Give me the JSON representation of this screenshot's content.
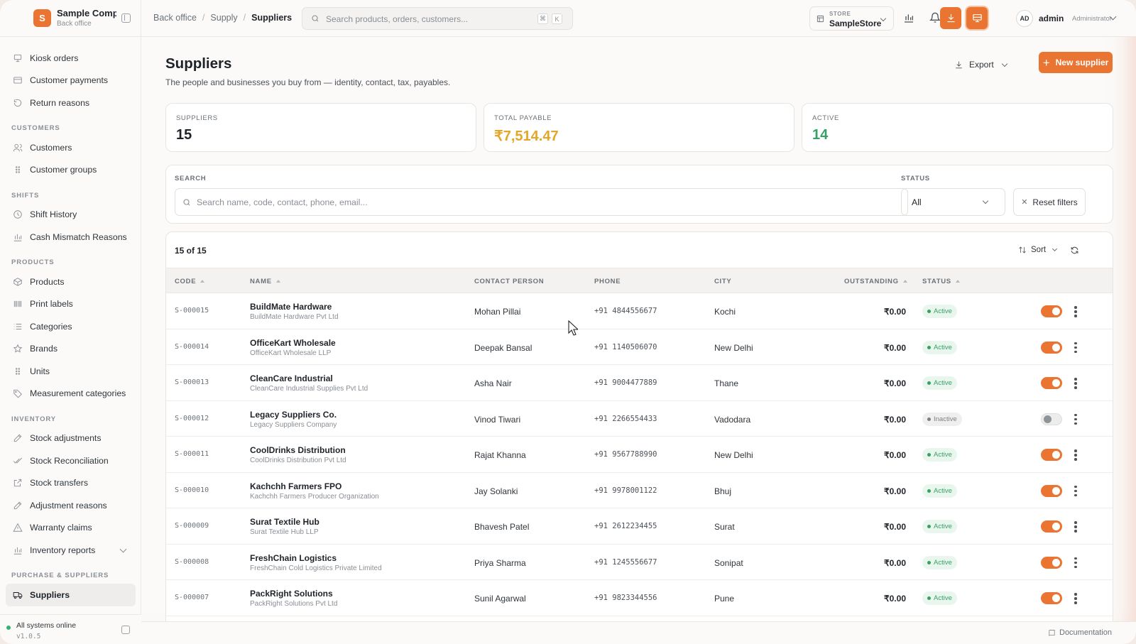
{
  "brand": {
    "name": "Sample Company",
    "sub": "Back office",
    "initial": "S"
  },
  "sidebar": {
    "groups": [
      {
        "section": "",
        "items": [
          {
            "label": "Kiosk orders",
            "icon": "kiosk-icon"
          },
          {
            "label": "Customer payments",
            "icon": "payments-icon"
          },
          {
            "label": "Return reasons",
            "icon": "return-icon"
          }
        ]
      },
      {
        "section": "CUSTOMERS",
        "items": [
          {
            "label": "Customers",
            "icon": "users-icon"
          },
          {
            "label": "Customer groups",
            "icon": "grip-icon"
          }
        ]
      },
      {
        "section": "SHIFTS",
        "items": [
          {
            "label": "Shift History",
            "icon": "clock-icon"
          },
          {
            "label": "Cash Mismatch Reasons",
            "icon": "bar-chart-icon"
          }
        ]
      },
      {
        "section": "PRODUCTS",
        "items": [
          {
            "label": "Products",
            "icon": "box-icon"
          },
          {
            "label": "Print labels",
            "icon": "barcode-icon"
          },
          {
            "label": "Categories",
            "icon": "list-icon"
          },
          {
            "label": "Brands",
            "icon": "star-icon"
          },
          {
            "label": "Units",
            "icon": "grip-icon"
          },
          {
            "label": "Measurement categories",
            "icon": "tag-icon"
          }
        ]
      },
      {
        "section": "INVENTORY",
        "items": [
          {
            "label": "Stock adjustments",
            "icon": "edit-icon"
          },
          {
            "label": "Stock Reconciliation",
            "icon": "check-check-icon"
          },
          {
            "label": "Stock transfers",
            "icon": "external-link-icon"
          },
          {
            "label": "Adjustment reasons",
            "icon": "edit-icon"
          },
          {
            "label": "Warranty claims",
            "icon": "alert-triangle-icon"
          },
          {
            "label": "Inventory reports",
            "icon": "bar-chart-icon",
            "expandable": true
          }
        ]
      },
      {
        "section": "PURCHASE & SUPPLIERS",
        "items": [
          {
            "label": "Suppliers",
            "icon": "truck-icon",
            "active": true
          }
        ]
      }
    ],
    "status": "All systems online",
    "version": "v1.0.5"
  },
  "topbar": {
    "breadcrumb": [
      "Back office",
      "Supply",
      "Suppliers"
    ],
    "search_placeholder": "Search products, orders, customers...",
    "kbd": [
      "⌘",
      "K"
    ],
    "store_label": "STORE",
    "store_value": "SampleStore",
    "user_initials": "AD",
    "user_name": "admin",
    "user_role": "Administrator"
  },
  "page": {
    "title": "Suppliers",
    "subtitle": "The people and businesses you buy from — identity, contact, tax, payables.",
    "export_label": "Export",
    "new_label": "New supplier"
  },
  "stats": [
    {
      "label": "SUPPLIERS",
      "value": "15",
      "color": "#1f2328"
    },
    {
      "label": "TOTAL PAYABLE",
      "value": "₹7,514.47",
      "color": "#e3a52a"
    },
    {
      "label": "ACTIVE",
      "value": "14",
      "color": "#37a063"
    }
  ],
  "filters": {
    "search_label": "SEARCH",
    "search_placeholder": "Search name, code, contact, phone, email...",
    "status_label": "STATUS",
    "status_value": "All",
    "reset_label": "Reset filters"
  },
  "table": {
    "count": "15 of 15",
    "sort_label": "Sort",
    "columns": [
      "CODE",
      "NAME",
      "CONTACT PERSON",
      "PHONE",
      "CITY",
      "OUTSTANDING",
      "STATUS"
    ],
    "rows": [
      {
        "code": "S-000015",
        "name": "BuildMate Hardware",
        "legal": "BuildMate Hardware Pvt Ltd",
        "contact": "Mohan Pillai",
        "phone": "+91 4844556677",
        "city": "Kochi",
        "outstanding": "₹0.00",
        "status": "Active",
        "enabled": true
      },
      {
        "code": "S-000014",
        "name": "OfficeKart Wholesale",
        "legal": "OfficeKart Wholesale LLP",
        "contact": "Deepak Bansal",
        "phone": "+91 1140506070",
        "city": "New Delhi",
        "outstanding": "₹0.00",
        "status": "Active",
        "enabled": true
      },
      {
        "code": "S-000013",
        "name": "CleanCare Industrial",
        "legal": "CleanCare Industrial Supplies Pvt Ltd",
        "contact": "Asha Nair",
        "phone": "+91 9004477889",
        "city": "Thane",
        "outstanding": "₹0.00",
        "status": "Active",
        "enabled": true
      },
      {
        "code": "S-000012",
        "name": "Legacy Suppliers Co.",
        "legal": "Legacy Suppliers Company",
        "contact": "Vinod Tiwari",
        "phone": "+91 2266554433",
        "city": "Vadodara",
        "outstanding": "₹0.00",
        "status": "Inactive",
        "enabled": false
      },
      {
        "code": "S-000011",
        "name": "CoolDrinks Distribution",
        "legal": "CoolDrinks Distribution Pvt Ltd",
        "contact": "Rajat Khanna",
        "phone": "+91 9567788990",
        "city": "New Delhi",
        "outstanding": "₹0.00",
        "status": "Active",
        "enabled": true
      },
      {
        "code": "S-000010",
        "name": "Kachchh Farmers FPO",
        "legal": "Kachchh Farmers Producer Organization",
        "contact": "Jay Solanki",
        "phone": "+91 9978001122",
        "city": "Bhuj",
        "outstanding": "₹0.00",
        "status": "Active",
        "enabled": true
      },
      {
        "code": "S-000009",
        "name": "Surat Textile Hub",
        "legal": "Surat Textile Hub LLP",
        "contact": "Bhavesh Patel",
        "phone": "+91 2612234455",
        "city": "Surat",
        "outstanding": "₹0.00",
        "status": "Active",
        "enabled": true
      },
      {
        "code": "S-000008",
        "name": "FreshChain Logistics",
        "legal": "FreshChain Cold Logistics Private Limited",
        "contact": "Priya Sharma",
        "phone": "+91 1245556677",
        "city": "Sonipat",
        "outstanding": "₹0.00",
        "status": "Active",
        "enabled": true
      },
      {
        "code": "S-000007",
        "name": "PackRight Solutions",
        "legal": "PackRight Solutions Pvt Ltd",
        "contact": "Sunil Agarwal",
        "phone": "+91 9823344556",
        "city": "Pune",
        "outstanding": "₹0.00",
        "status": "Active",
        "enabled": true
      }
    ]
  },
  "footer": {
    "docs_label": "Documentation"
  },
  "colors": {
    "accent": "#ea7431",
    "active": "#37a063",
    "payable": "#e3a52a"
  }
}
